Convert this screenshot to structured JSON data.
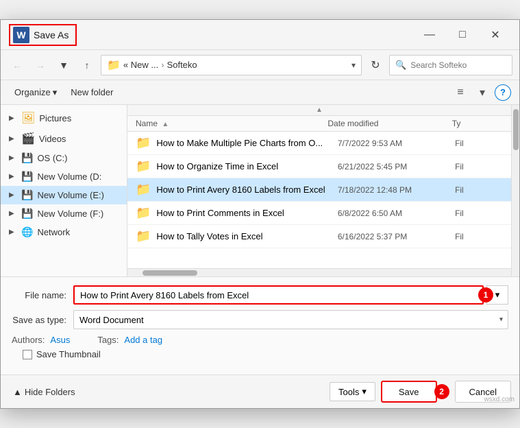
{
  "title_bar": {
    "title": "Save As",
    "close_label": "✕",
    "word_label": "W"
  },
  "address_bar": {
    "breadcrumb_icon": "📁",
    "breadcrumb_parts": [
      "New ...",
      "Softeko"
    ],
    "breadcrumb_separator": "›",
    "search_placeholder": "Search Softeko",
    "refresh_icon": "↻"
  },
  "toolbar": {
    "organize_label": "Organize",
    "new_folder_label": "New folder",
    "view_icon": "≡",
    "sort_icon": "▾",
    "help_label": "?"
  },
  "sidebar": {
    "items": [
      {
        "label": "Pictures",
        "icon": "🖼️",
        "has_chevron": true,
        "indent": 0
      },
      {
        "label": "Videos",
        "icon": "🎬",
        "has_chevron": true,
        "indent": 0
      },
      {
        "label": "OS (C:)",
        "icon": "💾",
        "has_chevron": true,
        "indent": 0
      },
      {
        "label": "New Volume (D:",
        "icon": "💾",
        "has_chevron": true,
        "indent": 0
      },
      {
        "label": "New Volume (E:)",
        "icon": "💾",
        "has_chevron": true,
        "selected": true,
        "indent": 0
      },
      {
        "label": "New Volume (F:)",
        "icon": "💾",
        "has_chevron": true,
        "indent": 0
      },
      {
        "label": "Network",
        "icon": "🌐",
        "has_chevron": true,
        "indent": 0
      }
    ]
  },
  "file_list": {
    "columns": [
      {
        "label": "Name",
        "sort": "▲"
      },
      {
        "label": "Date modified",
        "sort": ""
      },
      {
        "label": "Ty",
        "sort": ""
      }
    ],
    "rows": [
      {
        "name": "How to Make Multiple Pie Charts from O...",
        "date": "7/7/2022 9:53 AM",
        "type": "Fil"
      },
      {
        "name": "How to Organize Time in Excel",
        "date": "6/21/2022 5:45 PM",
        "type": "Fil"
      },
      {
        "name": "How to Print Avery 8160 Labels from Excel",
        "date": "7/18/2022 12:48 PM",
        "type": "Fil",
        "selected": true
      },
      {
        "name": "How to Print Comments in Excel",
        "date": "6/8/2022 6:50 AM",
        "type": "Fil"
      },
      {
        "name": "How to Tally Votes in Excel",
        "date": "6/16/2022 5:37 PM",
        "type": "Fil"
      }
    ]
  },
  "bottom_form": {
    "filename_label": "File name:",
    "filename_value": "How to Print Avery 8160 Labels from Excel",
    "filetype_label": "Save as type:",
    "filetype_value": "Word Document",
    "authors_label": "Authors:",
    "authors_value": "Asus",
    "tags_label": "Tags:",
    "tags_value": "Add a tag",
    "thumbnail_label": "Save Thumbnail",
    "badge_1": "1",
    "badge_2": "2"
  },
  "action_bar": {
    "hide_folders_label": "Hide Folders",
    "hide_folders_icon": "▲",
    "tools_label": "Tools",
    "tools_arrow": "▾",
    "save_label": "Save",
    "cancel_label": "Cancel"
  },
  "watermark": "wsxd.com"
}
